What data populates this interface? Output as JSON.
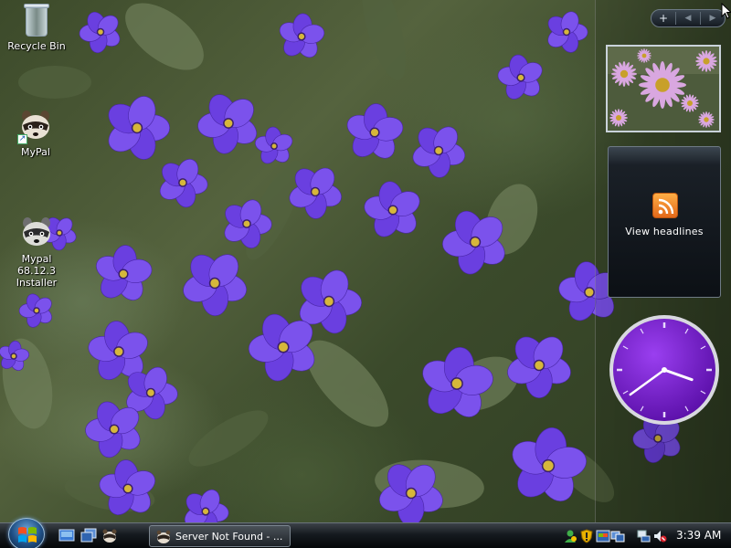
{
  "desktop": {
    "icons": [
      {
        "label": "Recycle Bin",
        "icon": "recycle-bin-icon"
      },
      {
        "label": "MyPal",
        "icon": "raccoon-icon"
      },
      {
        "label": "Mypal 68.12.3 Installer",
        "icon": "raccoon-installer-icon"
      }
    ],
    "wallpaper": "purple-flowers"
  },
  "sidebar": {
    "controls": {
      "add": "+",
      "prev": "◀",
      "next": "▶"
    },
    "slideshow": {
      "subject": "daisy-flowers-photo"
    },
    "feed_gadget": {
      "label": "View headlines",
      "icon": "rss-icon"
    },
    "clock_gadget": {
      "hour": 3,
      "minute": 39,
      "face_color": "#7a1ed1"
    }
  },
  "taskbar": {
    "start_icon": "windows-logo-icon",
    "quick_launch": [
      "show-desktop-icon",
      "switch-windows-icon",
      "mypal-icon"
    ],
    "task_button": {
      "label": "Server Not Found - ..."
    },
    "tray_icons": [
      "network-user-icon",
      "security-shield-icon",
      "windows-update-icon",
      "network-icon",
      "volume-muted-icon"
    ],
    "clock": "3:39 AM"
  },
  "colors": {
    "flower": "#6a3fe0",
    "flower_center": "#d6b73a",
    "taskbar": "#0a0d10",
    "clock_face": "#7a1ed1"
  }
}
